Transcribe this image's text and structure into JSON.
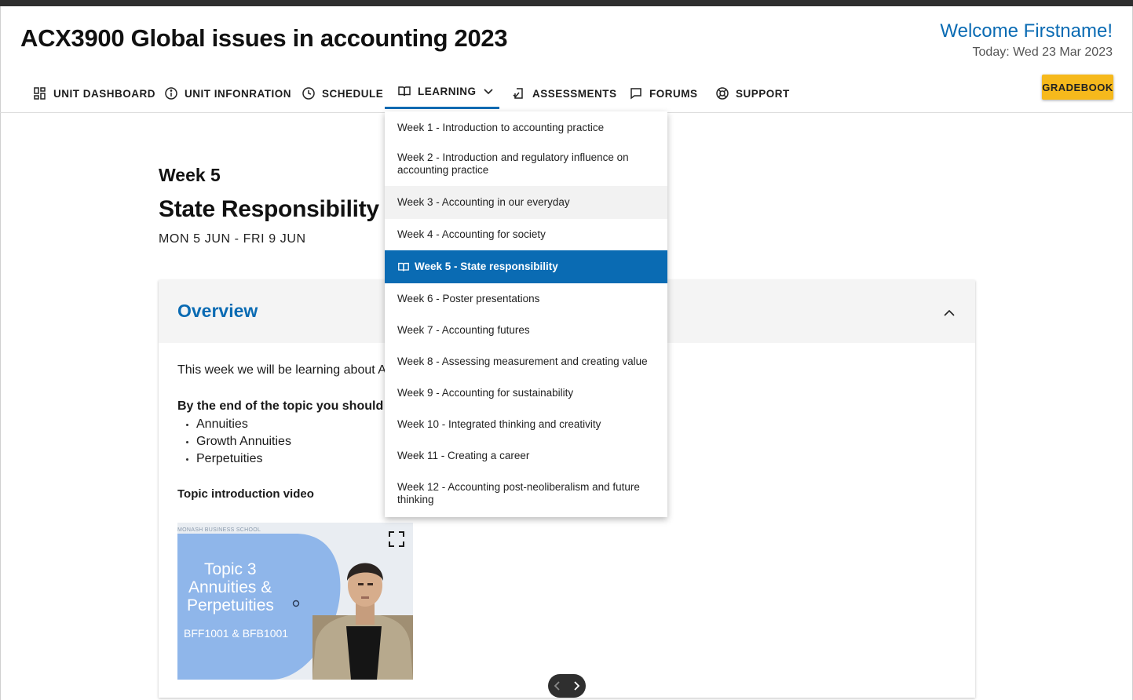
{
  "header": {
    "unit_title": "ACX3900 Global issues in accounting 2023",
    "welcome": "Welcome Firstname!",
    "today": "Today: Wed 23 Mar 2023",
    "gradebook_label": "GRADEBOOK"
  },
  "nav": {
    "items": [
      {
        "label": "UNIT DASHBOARD",
        "icon": "dashboard-icon"
      },
      {
        "label": "UNIT INFONRATION",
        "icon": "info-icon"
      },
      {
        "label": "SCHEDULE",
        "icon": "clock-icon"
      },
      {
        "label": "LEARNING",
        "icon": "book-icon",
        "active": true
      },
      {
        "label": "ASSESSMENTS",
        "icon": "assessment-icon"
      },
      {
        "label": "FORUMS",
        "icon": "chat-icon"
      },
      {
        "label": "SUPPORT",
        "icon": "lifebuoy-icon"
      }
    ],
    "active_color": "#0a6bb3"
  },
  "learning_menu": {
    "items": [
      "Week 1 - Introduction to accounting practice",
      "Week 2 - Introduction and regulatory influence on accounting practice",
      "Week 3 - Accounting in our everyday",
      "Week 4 - Accounting for society",
      "Week 5 - State responsibility",
      "Week 6 - Poster presentations",
      "Week 7 - Accounting futures",
      "Week 8 - Assessing measurement and creating value",
      "Week 9 - Accounting for sustainability",
      "Week 10 - Integrated thinking and creativity",
      "Week 11 - Creating a career",
      "Week 12 - Accounting post-neoliberalism and future thinking"
    ],
    "selected_index": 4,
    "hover_index": 2,
    "selected_color": "#0a6bb3"
  },
  "week": {
    "label": "Week 5",
    "title": "State Responsibility",
    "dates": "MON 5 JUN - FRI 9 JUN"
  },
  "overview": {
    "title": "Overview",
    "intro": "This week we will be learning about A",
    "objectives_heading": "By the end of the topic you should un",
    "objectives": [
      "Annuities",
      "Growth Annuities",
      "Perpetuities"
    ],
    "video_heading": "Topic introduction video",
    "video": {
      "brand": "MONASH BUSINESS SCHOOL",
      "title_line1": "Topic 3",
      "title_line2": "Annuities &",
      "title_line3": "Perpetuities",
      "subtitle": "BFF1001 & BFB1001"
    }
  },
  "colors": {
    "accent": "#0a6bb3",
    "gradebook": "#f6b91c",
    "card_header": "#f4f4f4"
  }
}
